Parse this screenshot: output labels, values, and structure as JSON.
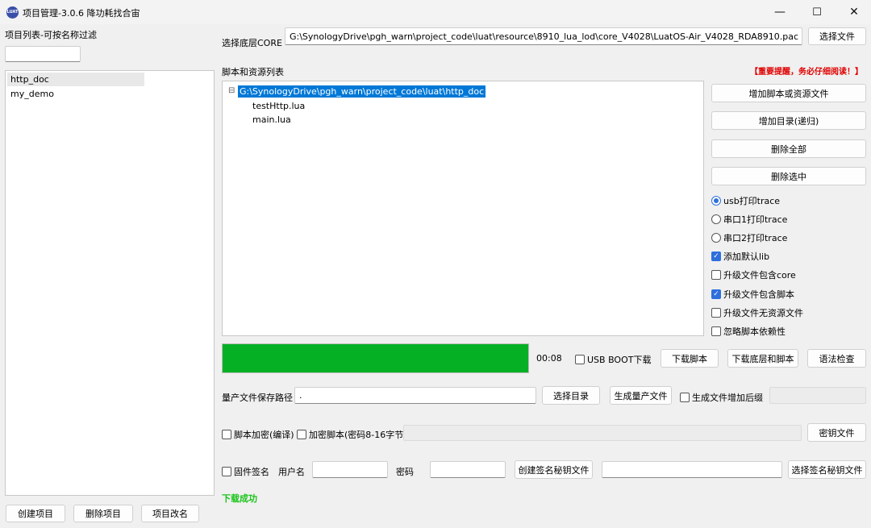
{
  "window": {
    "title": "项目管理-3.0.6 降功耗找合宙",
    "icon_label": "LUAT",
    "controls": {
      "minimize": "—",
      "maximize": "☐",
      "close": "✕"
    }
  },
  "left": {
    "filter_label": "项目列表-可按名称过滤",
    "filter_value": "",
    "projects": [
      "http_doc",
      "my_demo"
    ],
    "buttons": {
      "create": "创建项目",
      "delete": "删除项目",
      "rename": "项目改名"
    }
  },
  "core": {
    "label": "选择底层CORE",
    "path": "G:\\SynologyDrive\\pgh_warn\\project_code\\luat\\resource\\8910_lua_lod\\core_V4028\\LuatOS-Air_V4028_RDA8910.pac",
    "choose_button": "选择文件"
  },
  "scripts": {
    "label": "脚本和资源列表",
    "warning": "【重要提醒，务必仔细阅读！】",
    "tree_root": "G:\\SynologyDrive\\pgh_warn\\project_code\\luat\\http_doc",
    "tree_toggle": "⊟",
    "files": [
      "testHttp.lua",
      "main.lua"
    ]
  },
  "side_buttons": {
    "add_script": "增加脚本或资源文件",
    "add_dir": "增加目录(递归)",
    "delete_all": "删除全部",
    "delete_selected": "删除选中"
  },
  "options": {
    "radios": [
      {
        "label": "usb打印trace",
        "checked": true
      },
      {
        "label": "串口1打印trace",
        "checked": false
      },
      {
        "label": "串口2打印trace",
        "checked": false
      }
    ],
    "checks": [
      {
        "label": "添加默认lib",
        "checked": true
      },
      {
        "label": "升级文件包含core",
        "checked": false
      },
      {
        "label": "升级文件包含脚本",
        "checked": true
      },
      {
        "label": "升级文件无资源文件",
        "checked": false
      },
      {
        "label": "忽略脚本依赖性",
        "checked": false
      }
    ]
  },
  "progress": {
    "value": 1.0,
    "color": "#06b025",
    "time": "00:08",
    "usb_boot_label": "USB BOOT下载",
    "usb_boot_checked": false,
    "download_script": "下载脚本",
    "download_core_script": "下载底层和脚本",
    "syntax_check": "语法检查"
  },
  "production": {
    "label": "量产文件保存路径",
    "value": ".",
    "choose_dir": "选择目录",
    "generate": "生成量产文件",
    "suffix_label": "生成文件增加后缀",
    "suffix_checked": false,
    "suffix_value": ""
  },
  "encrypt": {
    "compile_label": "脚本加密(编译)",
    "compile_checked": false,
    "password_label": "加密脚本(密码8-16字节)",
    "password_checked": false,
    "password_value": "",
    "key_file": "密钥文件"
  },
  "sign": {
    "firmware_label": "固件签名",
    "firmware_checked": false,
    "username_label": "用户名",
    "username_value": "",
    "password_label": "密码",
    "password_value": "",
    "create_key": "创建签名秘钥文件",
    "key_path": "",
    "choose_key": "选择签名秘钥文件"
  },
  "status": {
    "text": "下载成功",
    "color": "#18c418"
  },
  "colors": {
    "warning": "#e00000",
    "selection": "#0078d7"
  }
}
